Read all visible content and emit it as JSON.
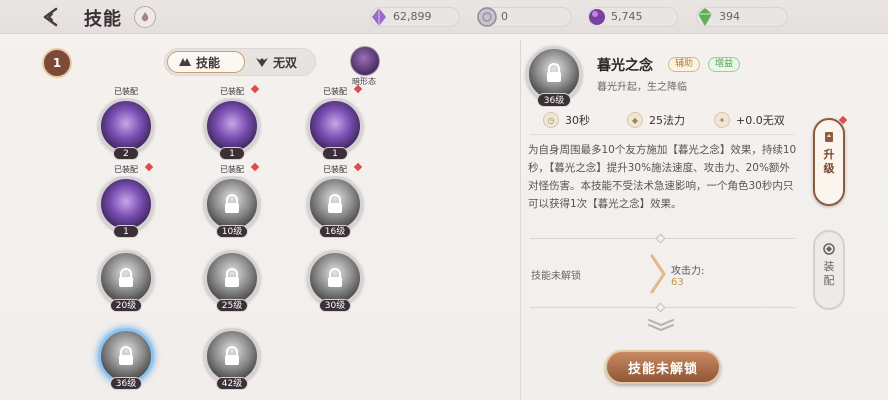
{
  "header": {
    "title": "技能",
    "resources": [
      {
        "icon": "purple-crystal-icon",
        "value": "62,899"
      },
      {
        "icon": "silver-coin-icon",
        "value": "0"
      },
      {
        "icon": "purple-orb-icon",
        "value": "5,745"
      },
      {
        "icon": "green-gem-icon",
        "value": "394"
      }
    ]
  },
  "left": {
    "level": "1",
    "tabs": [
      {
        "label": "技能",
        "active": true
      },
      {
        "label": "无双",
        "active": false
      }
    ],
    "form_label": "暗形态",
    "skills": [
      {
        "tag": "已装配",
        "badge": "2",
        "locked": false,
        "style": "purple"
      },
      {
        "tag": "已装配",
        "badge": "1",
        "locked": false,
        "style": "purple"
      },
      {
        "tag": "已装配",
        "badge": "1",
        "locked": false,
        "style": "purple"
      },
      {
        "tag": "已装配",
        "badge": "1",
        "locked": false,
        "style": "purple"
      },
      {
        "tag": "已装配",
        "badge": "10级",
        "locked": true,
        "style": "gray"
      },
      {
        "tag": "已装配",
        "badge": "16级",
        "locked": true,
        "style": "gray"
      },
      {
        "tag": "",
        "badge": "20级",
        "locked": true,
        "style": "gray"
      },
      {
        "tag": "",
        "badge": "25级",
        "locked": true,
        "style": "gray"
      },
      {
        "tag": "",
        "badge": "30级",
        "locked": true,
        "style": "gray"
      },
      {
        "tag": "",
        "badge": "36级",
        "locked": true,
        "style": "gray",
        "selected": true
      },
      {
        "tag": "",
        "badge": "42级",
        "locked": true,
        "style": "gray"
      }
    ]
  },
  "detail": {
    "level": "36级",
    "name": "暮光之念",
    "chips": [
      "辅助",
      "增益"
    ],
    "subtitle": "暮光升起，生之降临",
    "stats": [
      "30秒",
      "25法力",
      "+0.0无双"
    ],
    "description": "为自身周围最多10个友方施加【暮光之念】效果，持续10秒，【暮光之念】提升30%施法速度、攻击力、20%额外对怪伤害。本技能不受法术急速影响，一个角色30秒内只可以获得1次【暮光之念】效果。",
    "unlock_label": "技能未解锁",
    "attack_label": "攻击力:",
    "attack_value": "63",
    "button_label": "技能未解锁"
  },
  "side_tabs": {
    "upgrade": "升级",
    "equip": "装配"
  },
  "colors": {
    "accent": "#8f5637",
    "gold": "#c9954d",
    "assist_chip": "#b2813c",
    "buff_chip": "#4f9a4d"
  }
}
